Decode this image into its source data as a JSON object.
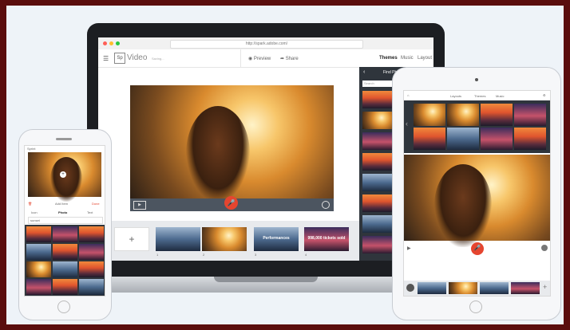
{
  "browser": {
    "url": "http://spark.adobe.com/"
  },
  "app": {
    "logo": "Sp",
    "title": "Video",
    "subtitle": "Saving...",
    "preview_label": "Preview",
    "share_label": "Share",
    "tabs": [
      {
        "label": "Themes"
      },
      {
        "label": "Music"
      },
      {
        "label": "Layout"
      }
    ]
  },
  "panel": {
    "title": "Find Photos",
    "search_placeholder": "Search"
  },
  "timeline": {
    "add_label": "+",
    "slides": [
      {
        "number": "1",
        "text": "",
        "style": "cool"
      },
      {
        "number": "2",
        "text": "",
        "style": "sun"
      },
      {
        "number": "3",
        "text": "Performances",
        "style": "cool"
      },
      {
        "number": "4",
        "text": "998,000 tickets sold",
        "style": "night"
      }
    ]
  },
  "tablet": {
    "tabs": [
      {
        "label": "Layouts"
      },
      {
        "label": "Themes"
      },
      {
        "label": "Music"
      }
    ]
  },
  "phone": {
    "status": "Sprint",
    "add_item": "Add Item",
    "done": "Done",
    "tabs": [
      {
        "label": "Icon"
      },
      {
        "label": "Photo"
      },
      {
        "label": "Text"
      }
    ],
    "search_value": "sunset"
  },
  "colors": {
    "accent": "#e5452f",
    "panel": "#2f353c",
    "device": "#1c1e22"
  }
}
